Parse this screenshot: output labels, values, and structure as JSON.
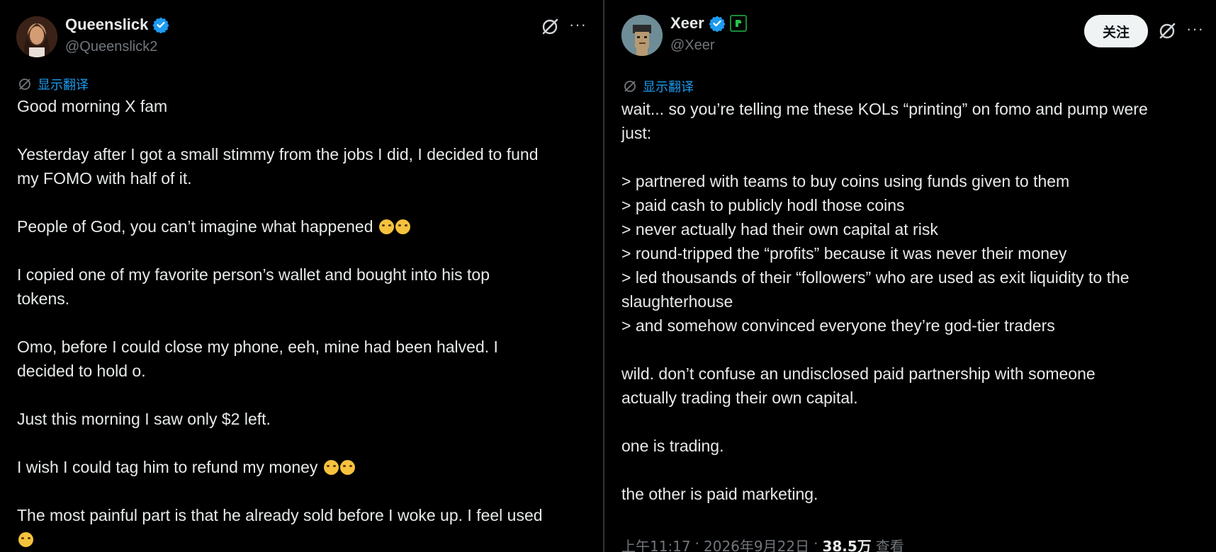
{
  "left_tweet": {
    "display_name": "Queenslick",
    "handle": "@Queenslick2",
    "verified_icon": "verified-badge-icon",
    "translate_label": "显示翻译",
    "body_lines": [
      [
        "Good morning X fam"
      ],
      [
        "Yesterday after I got a small stimmy from the jobs I did, I decided to fund",
        "my FOMO with half of it."
      ],
      [
        "People of God, you can’t imagine what happened"
      ],
      [
        "I copied one of my favorite person’s wallet and bought into his top",
        "tokens."
      ],
      [
        "Omo, before I could close my phone, eeh, mine had been halved. I",
        "decided to hold o."
      ],
      [
        "Just this morning I saw only $2 left."
      ],
      [
        "I wish I could tag him to refund my money"
      ],
      [
        "The most painful part is that he already sold before I woke up. I feel used"
      ]
    ]
  },
  "right_tweet": {
    "display_name": "Xeer",
    "handle": "@Xeer",
    "verified_icon": "verified-badge-icon",
    "affiliate_icon": "affiliate-badge-icon",
    "follow_label": "关注",
    "translate_label": "显示翻译",
    "body_lines": [
      [
        "wait... so you’re telling me these KOLs “printing” on fomo and pump were",
        "just:"
      ],
      [
        "> partnered with teams to buy coins using funds given to them",
        "> paid cash to publicly hodl those coins",
        "> never actually had their own capital at risk",
        "> round-tripped the “profits” because it was never their money",
        "> led thousands of their “followers” who are used as exit liquidity to the",
        "slaughterhouse",
        "> and somehow convinced everyone they’re god-tier traders"
      ],
      [
        "wild. don’t confuse an undisclosed paid partnership with someone",
        "actually trading their own capital."
      ],
      [
        "one is trading."
      ],
      [
        "the other is paid marketing."
      ]
    ],
    "meta": {
      "time": "上午11:17",
      "date": "2026年9月22日",
      "views_count": "38.5万",
      "views_label": "查看",
      "separator": "·"
    }
  },
  "colors": {
    "background": "#000000",
    "text": "#e7e9ea",
    "secondary": "#71767b",
    "accent": "#1d9bf0",
    "follow_bg": "#eff3f4"
  }
}
